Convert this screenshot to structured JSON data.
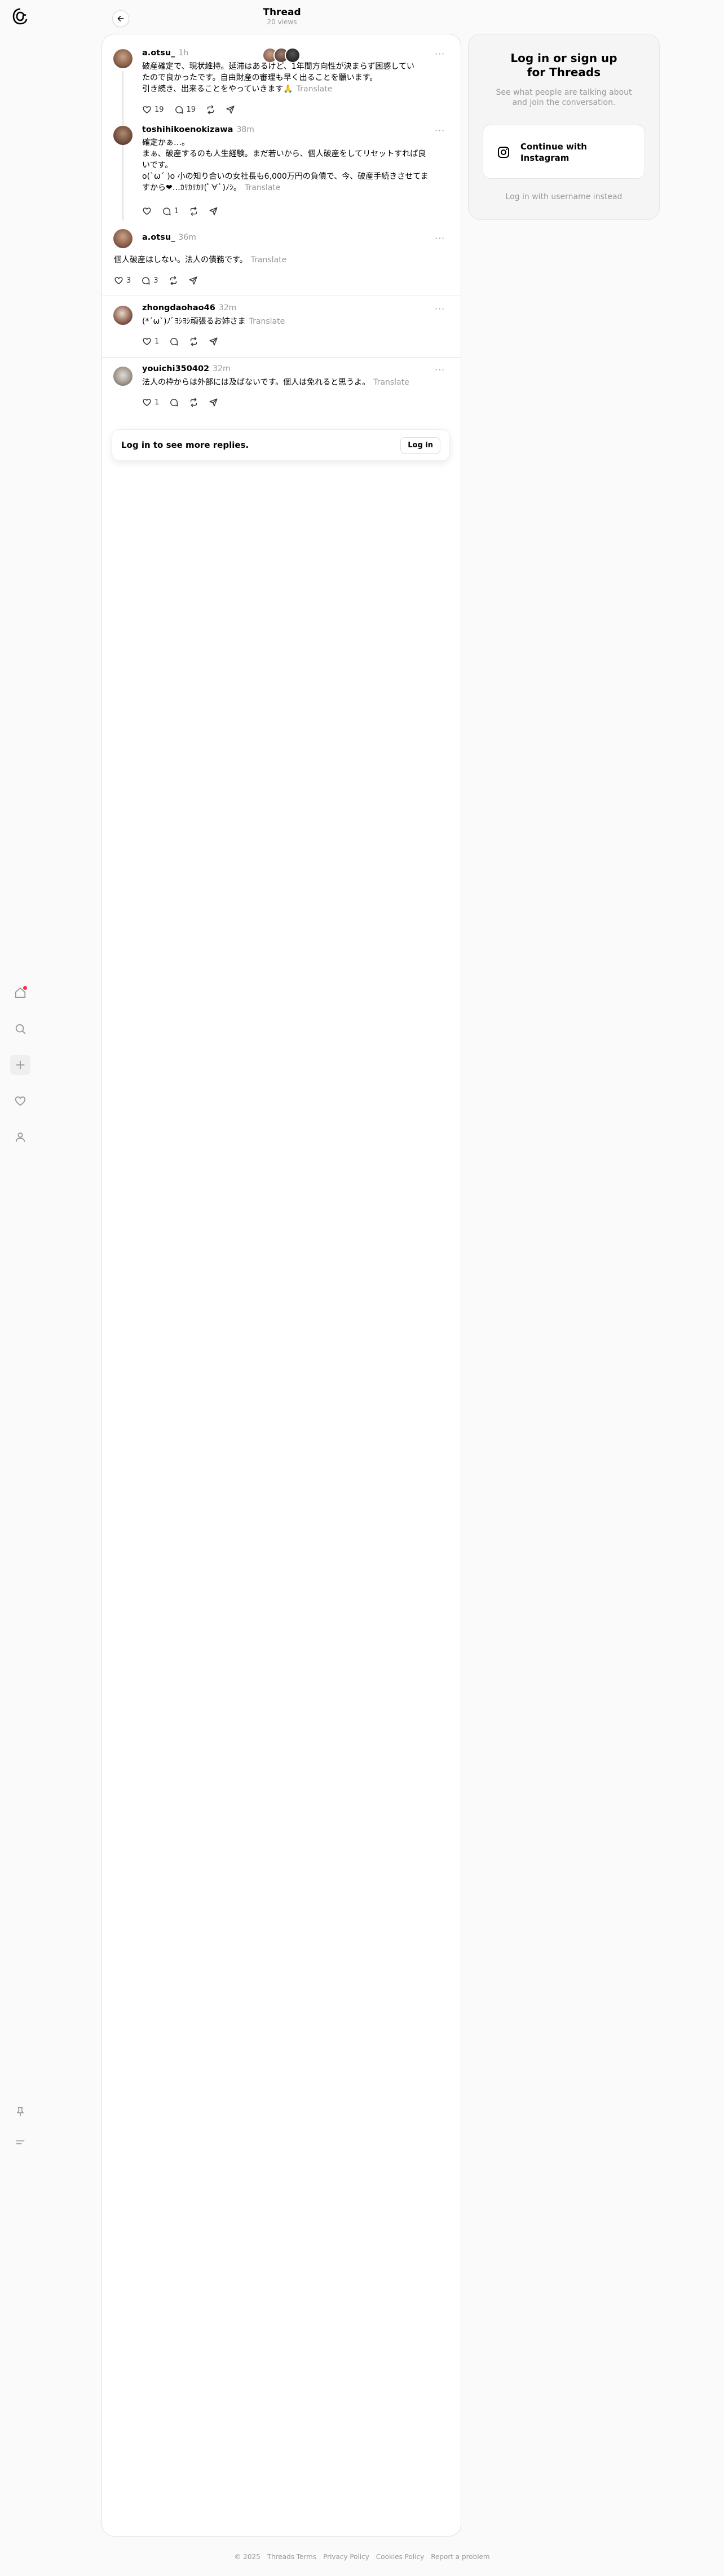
{
  "header": {
    "title": "Thread",
    "views": "20 views",
    "back_icon": "arrow-left-icon"
  },
  "left_nav": {
    "logo": "threads-logo",
    "items": [
      {
        "name": "home",
        "icon": "home-icon",
        "has_dot": true
      },
      {
        "name": "search",
        "icon": "search-icon"
      },
      {
        "name": "create",
        "icon": "plus-icon"
      },
      {
        "name": "activity",
        "icon": "heart-icon"
      },
      {
        "name": "profile",
        "icon": "user-icon"
      }
    ],
    "bottom": [
      {
        "name": "pin",
        "icon": "pin-icon"
      },
      {
        "name": "menu",
        "icon": "menu-icon"
      }
    ]
  },
  "posts": [
    {
      "username": "a.otsu_",
      "time": "1h",
      "lines": [
        "破産確定で、現状維持。延滞はあるけど、1年間方向性が決まらず困惑してい",
        "たので良かったです。自由財産の審理も早く出ることを願います。",
        "引き続き、出来ることをやっていきます🙏"
      ],
      "translate": "Translate",
      "likes": "19",
      "replies": "19"
    },
    {
      "username": "toshihikoenokizawa",
      "time": "38m",
      "lines": [
        "確定かぁ…。",
        "まぁ、破産するのも人生経験。まだ若いから、個人破産をしてリセットすれば良",
        "いです。",
        "o(`ω´ )o 小の知り合いの女社長も6,000万円の負債で、今、破産手続きさせてま",
        "すから❤…ｶﾘｶﾘｶﾘ(ﾟ∀ﾟ)ﾉｼ。"
      ],
      "translate": "Translate",
      "likes": "",
      "replies": "1"
    },
    {
      "username": "a.otsu_",
      "time": "36m",
      "lines": [
        "個人破産はしない。法人の債務です。"
      ],
      "translate": "Translate",
      "likes": "3",
      "replies": "3"
    },
    {
      "username": "zhongdaohao46",
      "time": "32m",
      "lines": [
        "(*´ω`)ﾉﾞﾖｼﾖｼ頑張るお姉さま"
      ],
      "translate": "Translate",
      "likes": "1",
      "replies": ""
    },
    {
      "username": "youichi350402",
      "time": "32m",
      "lines": [
        "法人の枠からは外部には及ばないです。個人は免れると思うよ。"
      ],
      "translate": "Translate",
      "likes": "1",
      "replies": ""
    }
  ],
  "login_banner": {
    "text": "Log in to see more replies.",
    "button": "Log in"
  },
  "side_card": {
    "title_line1": "Log in or sign up",
    "title_line2": "for Threads",
    "subtitle_line1": "See what people are talking about",
    "subtitle_line2": "and join the conversation.",
    "button_line1": "Continue with",
    "button_line2": "Instagram",
    "username_link": "Log in with username instead"
  },
  "footer": {
    "items": [
      "© 2025",
      "Threads Terms",
      "Privacy Policy",
      "Cookies Policy",
      "Report a problem"
    ]
  },
  "colors": {
    "notification_dot": "#ff3040",
    "muted_text": "#999999",
    "border": "#e0e0e0"
  }
}
